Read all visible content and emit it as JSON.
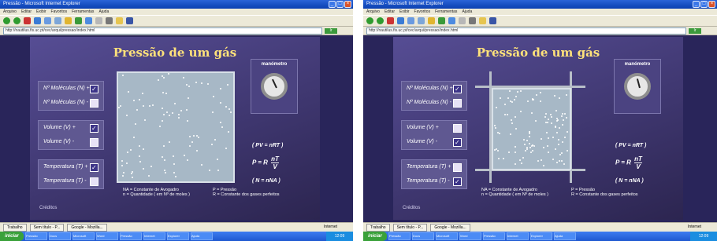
{
  "window_title": "Pressão - Microsoft Internet Explorer",
  "menu": [
    "Arquivo",
    "Editar",
    "Exibir",
    "Favoritos",
    "Ferramentas",
    "Ajuda"
  ],
  "address": "http://nautilus.fis.uc.pt/cec/arqui/pressao/index.html",
  "go_label": "Ir",
  "sim": {
    "title": "Pressão de um gás",
    "controls": {
      "molecules_plus": "Nº Moléculas (N) +",
      "molecules_minus": "Nº Moléculas (N) -",
      "volume_plus": "Volume (V) +",
      "volume_minus": "Volume (V) -",
      "temp_plus": "Temperatura (T) +",
      "temp_minus": "Temperatura (T) -"
    },
    "manometer_label": "manómetro",
    "formula_pv": "( PV = nRT )",
    "formula_p_left": "P = R",
    "formula_frac_num": "nT",
    "formula_frac_den": "V",
    "formula_n": "( N = nNA )",
    "creditos": "Créditos",
    "legend": {
      "na": "NA = Constante de Avogadro",
      "n": "n = Quantidade ( em Nº de moles )",
      "p": "P = Pressão",
      "r": "R = Constante dos gases perfeitos"
    }
  },
  "status": {
    "tab1": "Trabalho",
    "tab2": "Sem título - P...",
    "tab3": "Google - Mozilla...",
    "internet": "Internet"
  },
  "taskbar": {
    "start": "iniciar",
    "tasks": [
      "Pressão",
      "Docs",
      "Microsoft",
      "Word",
      "Pressão",
      "Internet",
      "Explorer",
      "Ajuda"
    ],
    "clock": "12:09"
  }
}
